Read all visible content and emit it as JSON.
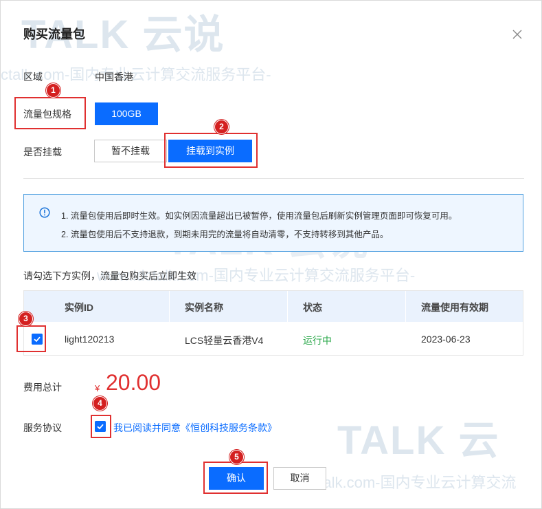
{
  "dialog": {
    "title": "购买流量包",
    "close_icon": "close-icon"
  },
  "form": {
    "region_label": "区域",
    "region_value": "中国香港",
    "spec_label": "流量包规格",
    "spec_value": "100GB",
    "mount_label": "是否挂载",
    "mount_options": [
      "暂不挂载",
      "挂载到实例"
    ],
    "mount_selected": "挂载到实例"
  },
  "notice": {
    "icon": "info-icon",
    "lines": [
      "1. 流量包使用后即时生效。如实例因流量超出已被暂停，使用流量包后刷新实例管理页面即可恢复可用。",
      "2. 流量包使用后不支持退款，到期未用完的流量将自动清零，不支持转移到其他产品。"
    ]
  },
  "instances": {
    "hint": "请勾选下方实例，流量包购买后立即生效",
    "columns": [
      "实例ID",
      "实例名称",
      "状态",
      "流量使用有效期"
    ],
    "rows": [
      {
        "checked": true,
        "id": "light120213",
        "name": "LCS轻量云香港V4",
        "status": "运行中",
        "expiry": "2023-06-23"
      }
    ]
  },
  "cost": {
    "label": "费用总计",
    "currency": "¥",
    "amount": "20.00"
  },
  "agreement": {
    "label": "服务协议",
    "checked": true,
    "text": "我已阅读并同意《恒创科技服务条款》"
  },
  "footer": {
    "confirm_label": "确认",
    "cancel_label": "取消"
  },
  "annotations": {
    "steps": [
      "1",
      "2",
      "3",
      "4",
      "5"
    ]
  },
  "watermarks": {
    "brand_big": "TALK 云说",
    "brand_big_2": "TALK 云",
    "url_line_1": "ctalk.com-国内专业云计算交流服务平台-",
    "url_line_2": "www.idctalk.com-国内专业云计算交流服务平台-",
    "url_line_3": "dctalk.com-国内专业云计算交流"
  },
  "colors": {
    "primary": "#0a6cff",
    "danger": "#e03030",
    "success": "#2aa84a",
    "notice_bg": "#eef6ff"
  }
}
